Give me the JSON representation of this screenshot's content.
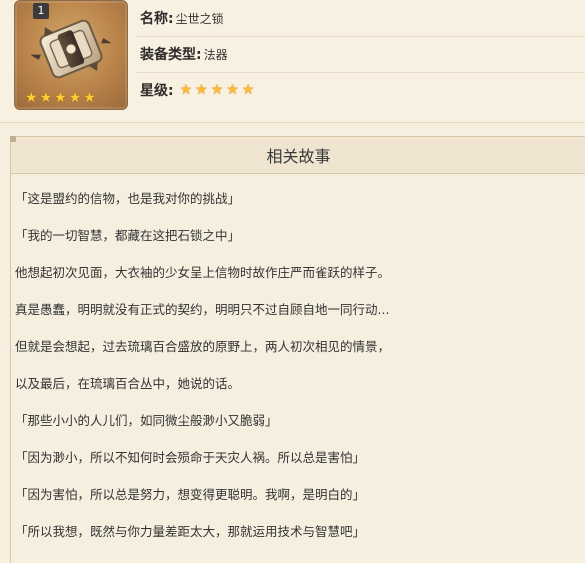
{
  "item": {
    "badge": "1",
    "icon": "stone-lock-catalyst-icon",
    "stars_count": 5
  },
  "info": {
    "name_label": "名称:",
    "name_value": "尘世之锁",
    "type_label": "装备类型:",
    "type_value": "法器",
    "rarity_label": "星级:",
    "rarity_stars": 5
  },
  "story": {
    "title": "相关故事",
    "lines": [
      "「这是盟约的信物，也是我对你的挑战」",
      "「我的一切智慧，都藏在这把石锁之中」",
      "他想起初次见面，大衣袖的少女呈上信物时故作庄严而雀跃的样子。",
      "真是愚蠢，明明就没有正式的契约，明明只不过自顾自地一同行动...",
      "但就是会想起，过去琉璃百合盛放的原野上，两人初次相见的情景，",
      "以及最后，在琉璃百合丛中，她说的话。",
      "「那些小小的人儿们，如同微尘般渺小又脆弱」",
      "「因为渺小，所以不知何时会殒命于天灾人祸。所以总是害怕」",
      "「因为害怕，所以总是努力，想变得更聪明。我啊，是明白的」",
      "「所以我想，既然与你力量差距太大，那就运用技术与智慧吧」"
    ]
  },
  "colors": {
    "background": "#f6efe0",
    "header_band": "#efe4cf",
    "border": "#d6c6a6",
    "star": "#ffbb33"
  }
}
